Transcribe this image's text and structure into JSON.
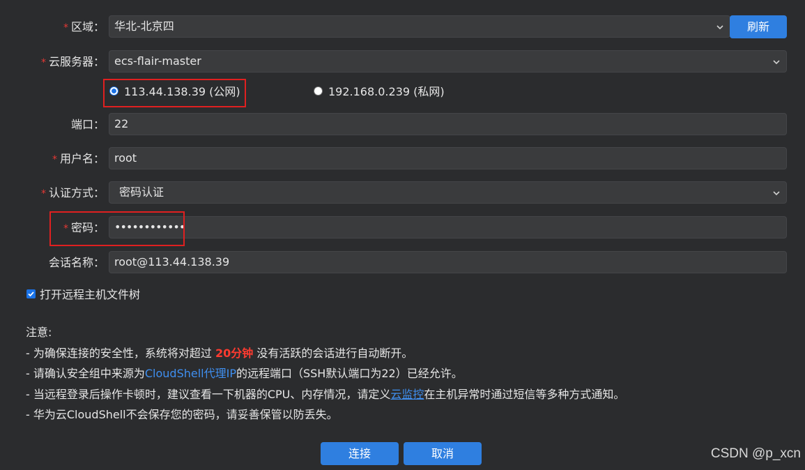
{
  "form": {
    "region": {
      "label": "区域",
      "value": "华北-北京四",
      "refresh_label": "刷新"
    },
    "server": {
      "label": "云服务器",
      "value": "ecs-flair-master"
    },
    "ip_options": [
      {
        "label": "113.44.138.39 (公网)",
        "checked": true
      },
      {
        "label": "192.168.0.239 (私网)",
        "checked": false
      }
    ],
    "port": {
      "label": "端口",
      "value": "22"
    },
    "username": {
      "label": "用户名",
      "value": "root"
    },
    "auth": {
      "label": "认证方式",
      "value": "密码认证"
    },
    "password": {
      "label": "密码",
      "value": "••••••••••••"
    },
    "session": {
      "label": "会话名称",
      "value": "root@113.44.138.39"
    },
    "colon": "：",
    "required_mark": "*",
    "open_tree": {
      "label": "打开远程主机文件树",
      "checked": true
    }
  },
  "notes": {
    "title": "注意:",
    "line1_a": "- 为确保连接的安全性，系统将对超过 ",
    "line1_b": "20分钟",
    "line1_c": " 没有活跃的会话进行自动断开。",
    "line2_a": "- 请确认安全组中来源为",
    "line2_b": "CloudShell代理IP",
    "line2_c": "的远程端口（SSH默认端口为22）已经允许。",
    "line3_a": "- 当远程登录后操作卡顿时，建议查看一下机器的CPU、内存情况，请定义",
    "line3_b": "云监控",
    "line3_c": "在主机异常时通过短信等多种方式通知。",
    "line4": "- 华为云CloudShell不会保存您的密码，请妥善保管以防丢失。"
  },
  "actions": {
    "connect": "连接",
    "cancel": "取消"
  },
  "watermark": "CSDN @p_xcn",
  "colors": {
    "accent": "#2f7fe0",
    "background": "#2b2c2e",
    "field": "#3a3b3d",
    "warn": "#ff3b30",
    "highlight_box": "#e02020"
  }
}
